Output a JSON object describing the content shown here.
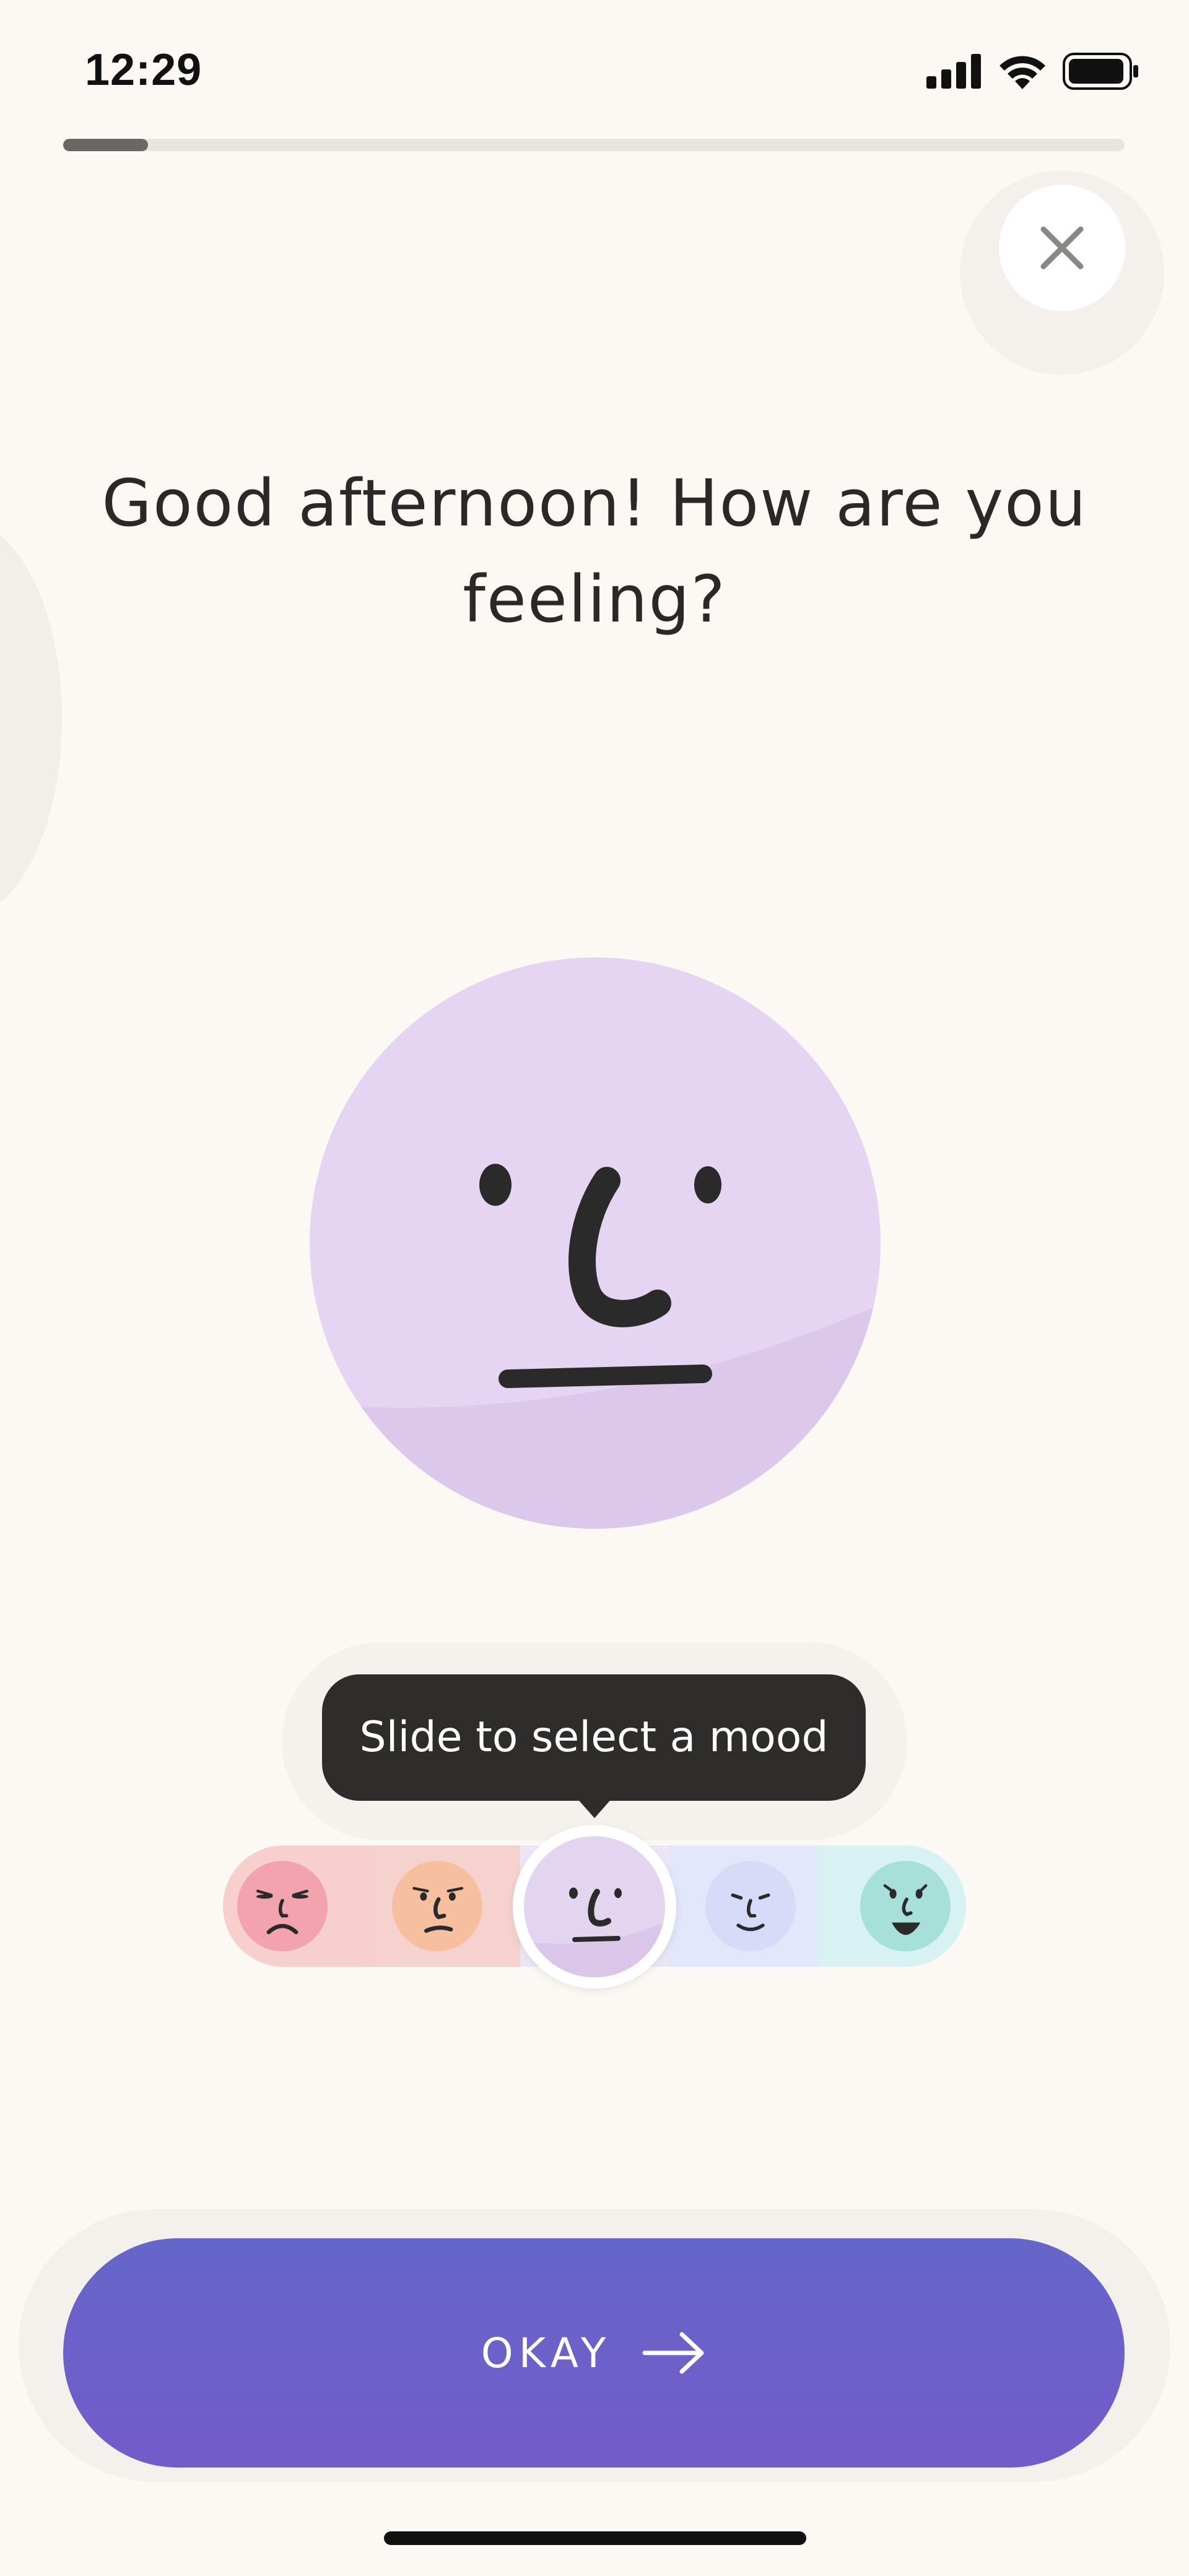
{
  "status_bar": {
    "time": "12:29",
    "icons": [
      "cellular-signal-icon",
      "wifi-icon",
      "battery-icon"
    ]
  },
  "progress": {
    "fraction": 0.08
  },
  "close_button": {
    "icon": "close-icon"
  },
  "headline": "Good afternoon! How are you feeling?",
  "mood_picker": {
    "tooltip": "Slide to select a mood",
    "selected_index": 2,
    "moods": [
      {
        "icon": "very-sad-face-icon",
        "color": "#f2a3ad"
      },
      {
        "icon": "sad-face-icon",
        "color": "#f6c0a0"
      },
      {
        "icon": "neutral-face-icon",
        "color": "#e3d4f0"
      },
      {
        "icon": "content-face-icon",
        "color": "#d6dcf8"
      },
      {
        "icon": "happy-face-icon",
        "color": "#a7e0d8"
      }
    ],
    "track_colors": [
      "#f7cfcd",
      "#f6d2cf",
      "#ece6f6",
      "#e1e8fb",
      "#d8f2f1"
    ]
  },
  "selected_mood_face": {
    "icon": "neutral-face-icon",
    "color": "#e6d5f2"
  },
  "ok_button": {
    "label": "OKAY",
    "icon": "arrow-right-icon",
    "gradient": [
      "#6566c9",
      "#735bc9"
    ]
  }
}
